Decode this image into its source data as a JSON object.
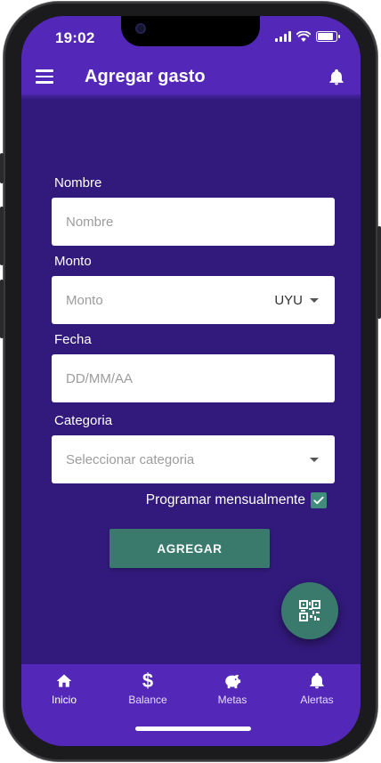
{
  "status_bar": {
    "time": "19:02"
  },
  "app_bar": {
    "title": "Agregar gasto"
  },
  "form": {
    "nombre": {
      "label": "Nombre",
      "placeholder": "Nombre"
    },
    "monto": {
      "label": "Monto",
      "placeholder": "Monto",
      "currency": "UYU"
    },
    "fecha": {
      "label": "Fecha",
      "placeholder": "DD/MM/AA"
    },
    "categoria": {
      "label": "Categoria",
      "placeholder": "Seleccionar categoria"
    },
    "schedule": {
      "label": "Programar mensualmente",
      "checked": true
    },
    "submit_label": "AGREGAR"
  },
  "fab": {
    "icon": "qr-code-icon"
  },
  "bottom_nav": [
    {
      "label": "Inicio",
      "icon": "home-icon",
      "active": true
    },
    {
      "label": "Balance",
      "icon": "dollar-icon",
      "active": false
    },
    {
      "label": "Metas",
      "icon": "piggy-bank-icon",
      "active": false
    },
    {
      "label": "Alertas",
      "icon": "bell-icon",
      "active": false
    }
  ],
  "colors": {
    "primary": "#5327b8",
    "background": "#321a7c",
    "accent": "#3a7a6d"
  }
}
